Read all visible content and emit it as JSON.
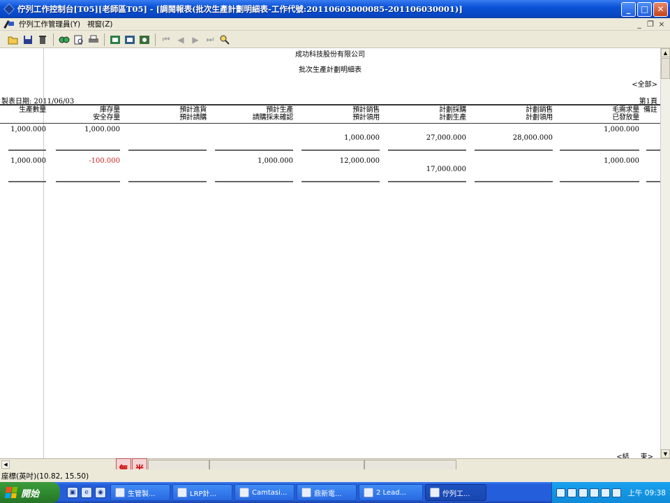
{
  "window": {
    "title": "佇列工作控制台[T05][老師區T05] - [調閱報表(批次生產計劃明細表-工作代號:20110603000085-201106030001)]",
    "buttons": {
      "minimize": "_",
      "maximize": "□",
      "close": "✕"
    }
  },
  "menu": {
    "items": [
      "佇列工作管理員(Y)",
      "視窗(Z)"
    ],
    "mdi": {
      "minimize": "_",
      "restore": "❐",
      "close": "×"
    }
  },
  "toolbar": {
    "icons": [
      "open-icon",
      "save-icon",
      "delete-icon",
      "find-icon",
      "preview-icon",
      "print-icon",
      "export-icon",
      "export2-icon",
      "export3-icon",
      "first-page-icon",
      "prev-page-icon",
      "next-page-icon",
      "last-page-icon",
      "search-icon"
    ]
  },
  "report": {
    "company": "成功科技股份有限公司",
    "title": "批次生產計劃明細表",
    "scope": "<全部>",
    "date_label": "製表日期: 2011/06/03",
    "page_label": "第1頁",
    "columns": [
      {
        "line1": "生產數量",
        "line2": ""
      },
      {
        "line1": "庫存量",
        "line2": "安全存量"
      },
      {
        "line1": "預計進貨",
        "line2": "預計請購"
      },
      {
        "line1": "預計生產",
        "line2": "請購採未確認"
      },
      {
        "line1": "預計銷售",
        "line2": "預計領用"
      },
      {
        "line1": "計劃採購",
        "line2": "計劃生產"
      },
      {
        "line1": "計劃銷售",
        "line2": "計劃領用"
      },
      {
        "line1": "毛需求量",
        "line2": "已發放量"
      },
      {
        "line1": "備註",
        "line2": ""
      }
    ],
    "rows": [
      {
        "qty": "1,000.000",
        "stock": "1,000.000",
        "plan_produce": "",
        "sales": "1,000.000",
        "plan_purchase": "27,000.000",
        "plan_sales": "28,000.000",
        "gross": "1,000.000"
      },
      {
        "qty": "1,000.000",
        "stock": "-100.000",
        "plan_produce": "1,000.000",
        "sales": "12,000.000",
        "plan_purchase": "17,000.000",
        "plan_sales": "",
        "gross": "1,000.000"
      }
    ],
    "footer_left": "<結",
    "footer_right": "束>"
  },
  "ime": {
    "char1": "無",
    "char2": "半"
  },
  "status": {
    "coord": "座標(英吋)(10.82, 15.50)"
  },
  "taskbar": {
    "start": "開始",
    "tasks": [
      "生管製...",
      "LRP計...",
      "Camtasi...",
      "鼎新電...",
      "2 Lead...",
      "佇列工..."
    ],
    "clock": "上午 09:38"
  }
}
